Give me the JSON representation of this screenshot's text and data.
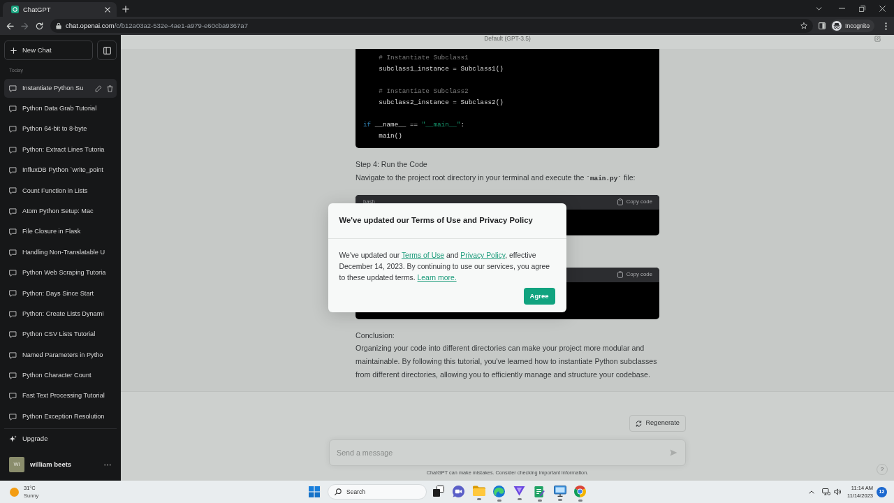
{
  "browser": {
    "tab": {
      "title": "ChatGPT"
    },
    "navigation": {
      "back_disabled": false,
      "forward_disabled": true
    },
    "address": {
      "host": "chat.openai.com",
      "path": "/c/b12a03a2-532e-4ae1-a979-e60cba9367a7"
    },
    "profile": {
      "label": "Incognito"
    }
  },
  "sidebar": {
    "new_chat": "New Chat",
    "section": "Today",
    "chats": [
      {
        "title": "Instantiate Python Su",
        "selected": true
      },
      {
        "title": "Python Data Grab Tutorial",
        "selected": false
      },
      {
        "title": "Python 64-bit to 8-byte",
        "selected": false
      },
      {
        "title": "Python: Extract Lines Tutoria",
        "selected": false
      },
      {
        "title": "InfluxDB Python `write_point",
        "selected": false
      },
      {
        "title": "Count Function in Lists",
        "selected": false
      },
      {
        "title": "Atom Python Setup: Mac",
        "selected": false
      },
      {
        "title": "File Closure in Flask",
        "selected": false
      },
      {
        "title": "Handling Non-Translatable U",
        "selected": false
      },
      {
        "title": "Python Web Scraping Tutoria",
        "selected": false
      },
      {
        "title": "Python: Days Since Start",
        "selected": false
      },
      {
        "title": "Python: Create Lists Dynami",
        "selected": false
      },
      {
        "title": "Python CSV Lists Tutorial",
        "selected": false
      },
      {
        "title": "Named Parameters in Pytho",
        "selected": false
      },
      {
        "title": "Python Character Count",
        "selected": false
      },
      {
        "title": "Fast Text Processing Tutorial",
        "selected": false
      },
      {
        "title": "Python Exception Resolution",
        "selected": false
      }
    ],
    "upgrade": "Upgrade",
    "user": {
      "initials": "WI",
      "name": "william beets"
    }
  },
  "header": {
    "model": "Default (GPT-3.5)"
  },
  "message": [
    {
      "kind": "code",
      "groups": [
        {
          "lines": [
            [
              {
                "kind": "comment",
                "text": "    # Instantiate Subclass1"
              }
            ],
            [
              {
                "kind": "plain",
                "text": "    subclass1_instance = Subclass1()"
              }
            ]
          ]
        },
        {
          "lines": [
            [
              {
                "kind": "comment",
                "text": "    # Instantiate Subclass2"
              }
            ],
            [
              {
                "kind": "plain",
                "text": "    subclass2_instance = Subclass2()"
              }
            ]
          ]
        },
        {
          "lines": [
            [
              {
                "kind": "keyword",
                "text": "if"
              },
              {
                "kind": "plain",
                "text": " __name__ == "
              },
              {
                "kind": "string",
                "text": "\"__main__\""
              },
              {
                "kind": "plain",
                "text": ":"
              }
            ],
            [
              {
                "kind": "plain",
                "text": "    main()"
              }
            ]
          ]
        }
      ]
    },
    {
      "kind": "text",
      "parts": [
        {
          "kind": "plain",
          "text": "Step 4: Run the Code"
        }
      ]
    },
    {
      "kind": "text",
      "parts": [
        {
          "kind": "plain",
          "text": "Navigate to the project root directory in your terminal and execute the "
        },
        {
          "kind": "code",
          "text": "`main.py`"
        },
        {
          "kind": "plain",
          "text": " file:"
        }
      ]
    },
    {
      "kind": "code",
      "language": "bash",
      "copy": "Copy code"
    },
    {
      "kind": "code",
      "copy": "Copy code"
    },
    {
      "kind": "text",
      "parts": [
        {
          "kind": "plain",
          "text": "Conclusion:"
        }
      ]
    },
    {
      "kind": "text",
      "parts": [
        {
          "kind": "plain",
          "text": "Organizing your code into different directories can make your project more modular and maintainable. By following this tutorial, you've learned how to instantiate Python subclasses from different directories, allowing you to efficiently manage and structure your codebase."
        }
      ]
    }
  ],
  "composer": {
    "regenerate": "Regenerate",
    "placeholder": "Send a message",
    "disclaimer": "ChatGPT can make mistakes. Consider checking important information.",
    "help": "?"
  },
  "dialog": {
    "title": "We've updated our Terms of Use and Privacy Policy",
    "body": [
      {
        "kind": "text",
        "text": "We've updated our "
      },
      {
        "kind": "link",
        "text": "Terms of Use"
      },
      {
        "kind": "text",
        "text": " and "
      },
      {
        "kind": "link",
        "text": "Privacy Policy"
      },
      {
        "kind": "text",
        "text": ", effective December 14, 2023. By continuing to use our services, you agree to these updated terms. "
      },
      {
        "kind": "link",
        "text": "Learn more."
      }
    ],
    "button": "Agree"
  },
  "taskbar": {
    "weather": {
      "temperature": "31°C",
      "condition": "Sunny"
    },
    "search": "Search",
    "apps": [
      {
        "kind": "task_view",
        "running": false
      },
      {
        "kind": "meet",
        "running": false
      },
      {
        "kind": "folder",
        "running": true
      },
      {
        "kind": "edge",
        "running": true
      },
      {
        "kind": "vpn",
        "running": true
      },
      {
        "kind": "notes",
        "running": true
      },
      {
        "kind": "remote",
        "running": true
      },
      {
        "kind": "chrome",
        "running": true
      }
    ],
    "clock": {
      "time": "11:14 AM",
      "date": "11/14/2023"
    },
    "notifications": "12"
  }
}
